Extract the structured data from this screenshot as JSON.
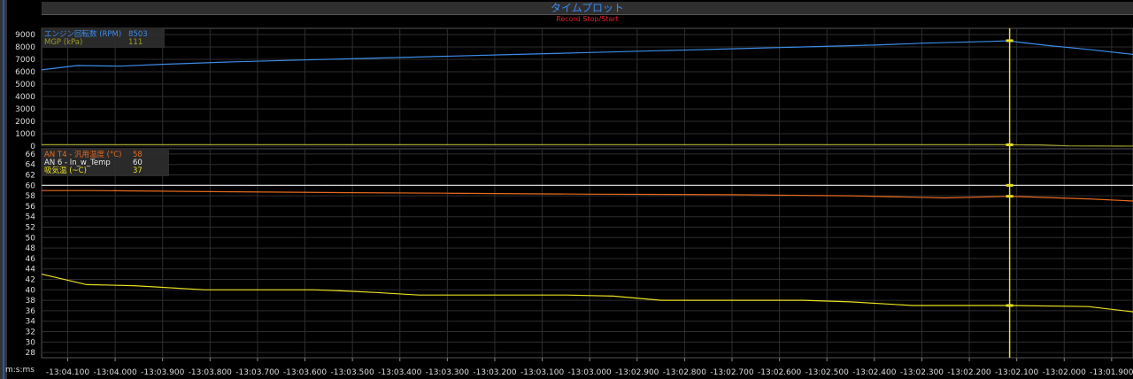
{
  "window": {
    "title": "タイムプロット",
    "record_label": "Record Stop/Start"
  },
  "x_axis_label": "m:s:ms",
  "colors": {
    "rpm": "#3c8ce8",
    "mgp": "#9a9a2a",
    "an_t4": "#e86a1e",
    "an6": "#e8e8e8",
    "intake": "#e8e020",
    "cursor": "#e8e020",
    "grid": "#2e2e2e",
    "background": "#000000"
  },
  "chart_data": [
    {
      "type": "line",
      "title": "",
      "xlabel": "m:s:ms",
      "ylabel": "",
      "ylim": [
        0,
        9500
      ],
      "xlim": [
        -13.04155,
        -13.01855
      ],
      "yticks": [
        0,
        1000,
        2000,
        3000,
        4000,
        5000,
        6000,
        7000,
        8000,
        9000
      ],
      "xticks": [
        -13.041,
        -13.04,
        -13.039,
        -13.038,
        -13.037,
        -13.036,
        -13.035,
        -13.034,
        -13.033,
        -13.032,
        -13.031,
        -13.03,
        -13.029,
        -13.028,
        -13.027,
        -13.026,
        -13.025,
        -13.024,
        -13.023,
        -13.022,
        -13.021,
        -13.02,
        -13.019
      ],
      "xtick_labels": [
        "-13:04.100",
        "-13:04.000",
        "-13:03.900",
        "-13:03.800",
        "-13:03.700",
        "-13:03.600",
        "-13:03.500",
        "-13:03.400",
        "-13:03.300",
        "-13:03.200",
        "-13:03.100",
        "-13:03.000",
        "-13:02.900",
        "-13:02.800",
        "-13:02.700",
        "-13:02.600",
        "-13:02.500",
        "-13:02.400",
        "-13:02.300",
        "-13:02.200",
        "-13:02.100",
        "-13:02.000",
        "-13:01.900"
      ],
      "cursor_x": -13.02115,
      "legend": {
        "position": "top-left",
        "entries": [
          {
            "name": "エンジン回転数 (RPM)",
            "value": "8503",
            "color": "#3c8ce8"
          },
          {
            "name": "MGP (kPa)",
            "value": "111",
            "color": "#9a9a2a"
          }
        ]
      },
      "series": [
        {
          "name": "エンジン回転数 (RPM)",
          "x": [
            -13.04155,
            -13.0408,
            -13.0399,
            -13.039,
            -13.0375,
            -13.036,
            -13.0345,
            -13.033,
            -13.0315,
            -13.03,
            -13.0285,
            -13.027,
            -13.0255,
            -13.024,
            -13.023,
            -13.0215,
            -13.02115,
            -13.021,
            -13.0203,
            -13.0195,
            -13.01855
          ],
          "y": [
            6150,
            6500,
            6450,
            6600,
            6800,
            6950,
            7100,
            7250,
            7400,
            7550,
            7700,
            7850,
            8000,
            8150,
            8300,
            8450,
            8503,
            8400,
            8100,
            7800,
            7400
          ]
        },
        {
          "name": "MGP (kPa)",
          "x": [
            -13.04155,
            -13.0215,
            -13.02115,
            -13.0205,
            -13.0199,
            -13.01855
          ],
          "y": [
            111,
            111,
            111,
            100,
            20,
            0
          ]
        }
      ]
    },
    {
      "type": "line",
      "title": "",
      "xlabel": "m:s:ms",
      "ylabel": "",
      "ylim": [
        27,
        67
      ],
      "xlim": [
        -13.04155,
        -13.01855
      ],
      "yticks": [
        28,
        30,
        32,
        34,
        36,
        38,
        40,
        42,
        44,
        46,
        48,
        50,
        52,
        54,
        56,
        58,
        60,
        62,
        64,
        66
      ],
      "cursor_x": -13.02115,
      "legend": {
        "position": "top-left",
        "entries": [
          {
            "name": "AN T4 - 汎用温度 (°C)",
            "value": "58",
            "color": "#e86a1e"
          },
          {
            "name": "AN 6 - In_w_Temp",
            "value": "60",
            "color": "#e8e8e8"
          },
          {
            "name": "吸気温 (~C)",
            "value": "37",
            "color": "#e8e020"
          }
        ]
      },
      "series": [
        {
          "name": "AN T4 - 汎用温度 (°C)",
          "x": [
            -13.04155,
            -13.0405,
            -13.038,
            -13.035,
            -13.033,
            -13.03,
            -13.027,
            -13.0245,
            -13.0225,
            -13.02115,
            -13.0195,
            -13.01855
          ],
          "y": [
            59,
            59,
            58.8,
            58.6,
            58.5,
            58.3,
            58.2,
            58,
            57.6,
            57.9,
            57.4,
            57
          ]
        },
        {
          "name": "AN 6 - In_w_Temp",
          "x": [
            -13.04155,
            -13.01855
          ],
          "y": [
            60,
            60
          ]
        },
        {
          "name": "吸気温 (~C)",
          "x": [
            -13.04155,
            -13.0406,
            -13.0396,
            -13.0381,
            -13.0358,
            -13.0352,
            -13.0345,
            -13.0336,
            -13.0318,
            -13.0305,
            -13.0295,
            -13.0285,
            -13.0265,
            -13.0255,
            -13.0245,
            -13.0232,
            -13.0215,
            -13.02115,
            -13.0195,
            -13.01855
          ],
          "y": [
            43,
            41,
            40.8,
            40,
            40,
            39.8,
            39.5,
            39,
            39,
            39,
            38.8,
            38,
            38,
            38,
            37.7,
            37,
            37,
            37,
            36.8,
            35.8
          ]
        }
      ]
    }
  ]
}
